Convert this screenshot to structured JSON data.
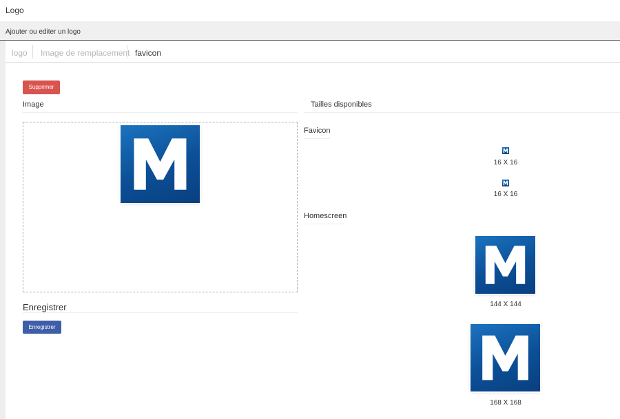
{
  "page": {
    "title": "Logo"
  },
  "section": {
    "label": "Ajouter ou editer un logo"
  },
  "tabs": [
    {
      "label": "logo",
      "active": false
    },
    {
      "label": "Image de remplacement",
      "active": false
    },
    {
      "label": "favicon",
      "active": true
    }
  ],
  "actions": {
    "delete_label": "Supprimer",
    "save_label": "Enregistrer"
  },
  "image_panel": {
    "heading": "Image",
    "icon": "m-logo-icon"
  },
  "save_section": {
    "heading": "Enregistrer"
  },
  "sizes_panel": {
    "heading": "Tailles disponibles",
    "groups": [
      {
        "name": "Favicon",
        "sizes": [
          "16 X 16",
          "16 X 16"
        ]
      },
      {
        "name": "Homescreen",
        "sizes": [
          "144 X 144",
          "168 X 168"
        ]
      }
    ]
  },
  "colors": {
    "danger": "#d9534f",
    "primary": "#3f5ea8",
    "logo_blue": "#0b4f96"
  }
}
